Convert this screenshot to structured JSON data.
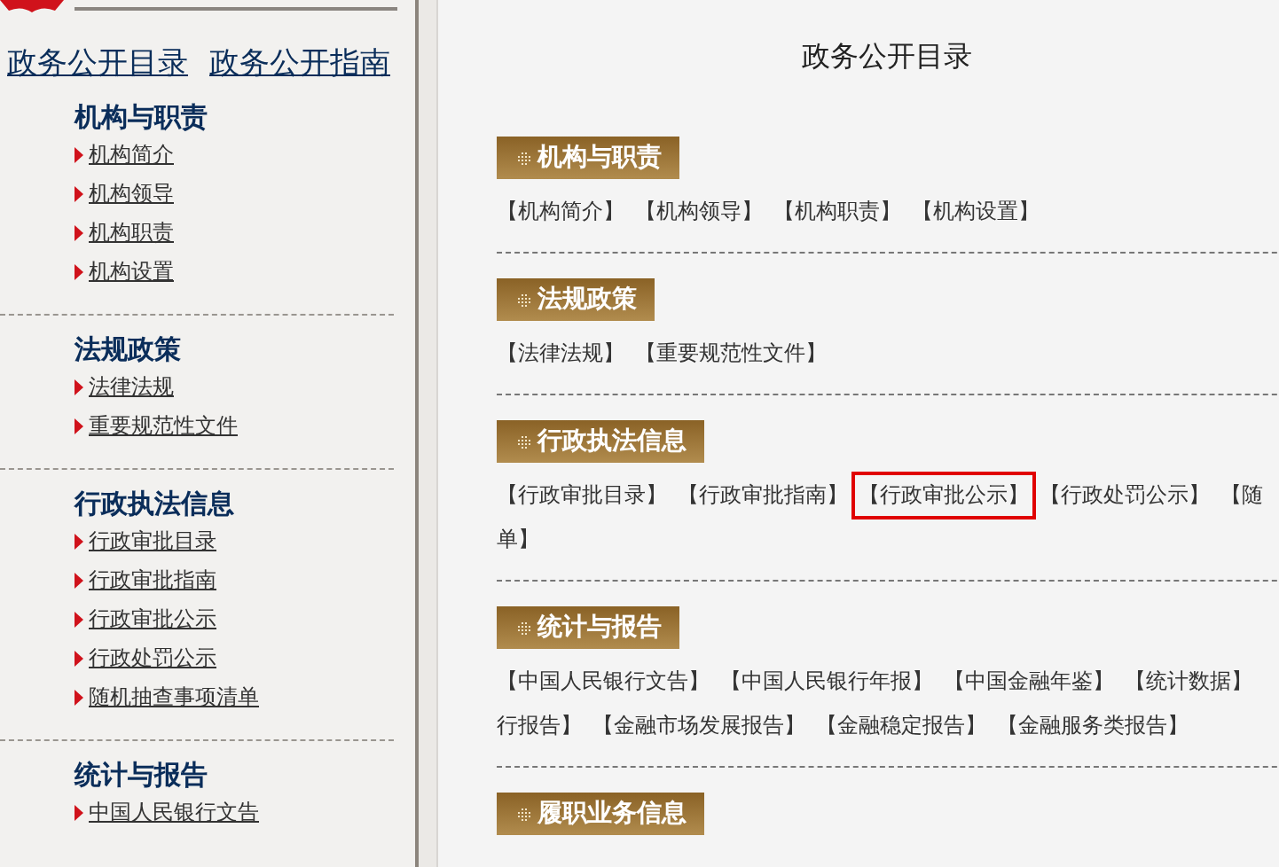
{
  "sidebar": {
    "nav_links": [
      {
        "label": "政务公开目录"
      },
      {
        "label": "政务公开指南"
      }
    ],
    "groups": [
      {
        "title": "机构与职责",
        "items": [
          "机构简介",
          "机构领导",
          "机构职责",
          "机构设置"
        ]
      },
      {
        "title": "法规政策",
        "items": [
          "法律法规",
          "重要规范性文件"
        ]
      },
      {
        "title": "行政执法信息",
        "items": [
          "行政审批目录",
          "行政审批指南",
          "行政审批公示",
          "行政处罚公示",
          "随机抽查事项清单"
        ]
      },
      {
        "title": "统计与报告",
        "items": [
          "中国人民银行文告"
        ]
      }
    ]
  },
  "main": {
    "title": "政务公开目录",
    "sections": [
      {
        "title": "机构与职责",
        "lines": [
          [
            {
              "label": "【机构简介】",
              "highlighted": false
            },
            {
              "label": "【机构领导】",
              "highlighted": false
            },
            {
              "label": "【机构职责】",
              "highlighted": false
            },
            {
              "label": "【机构设置】",
              "highlighted": false
            }
          ]
        ]
      },
      {
        "title": "法规政策",
        "lines": [
          [
            {
              "label": "【法律法规】",
              "highlighted": false
            },
            {
              "label": "【重要规范性文件】",
              "highlighted": false
            }
          ]
        ]
      },
      {
        "title": "行政执法信息",
        "lines": [
          [
            {
              "label": "【行政审批目录】",
              "highlighted": false
            },
            {
              "label": "【行政审批指南】",
              "highlighted": false
            },
            {
              "label": "【行政审批公示】",
              "highlighted": true
            },
            {
              "label": "【行政处罚公示】",
              "highlighted": false
            },
            {
              "label": "【随",
              "highlighted": false
            }
          ],
          [
            {
              "label": "单】",
              "highlighted": false
            }
          ]
        ]
      },
      {
        "title": "统计与报告",
        "lines": [
          [
            {
              "label": "【中国人民银行文告】",
              "highlighted": false
            },
            {
              "label": "【中国人民银行年报】",
              "highlighted": false
            },
            {
              "label": "【中国金融年鉴】",
              "highlighted": false
            },
            {
              "label": "【统计数据】",
              "highlighted": false
            }
          ],
          [
            {
              "label": "行报告】",
              "highlighted": false
            },
            {
              "label": "【金融市场发展报告】",
              "highlighted": false
            },
            {
              "label": "【金融稳定报告】",
              "highlighted": false
            },
            {
              "label": "【金融服务类报告】",
              "highlighted": false
            }
          ]
        ]
      },
      {
        "title": "履职业务信息"
      }
    ]
  }
}
